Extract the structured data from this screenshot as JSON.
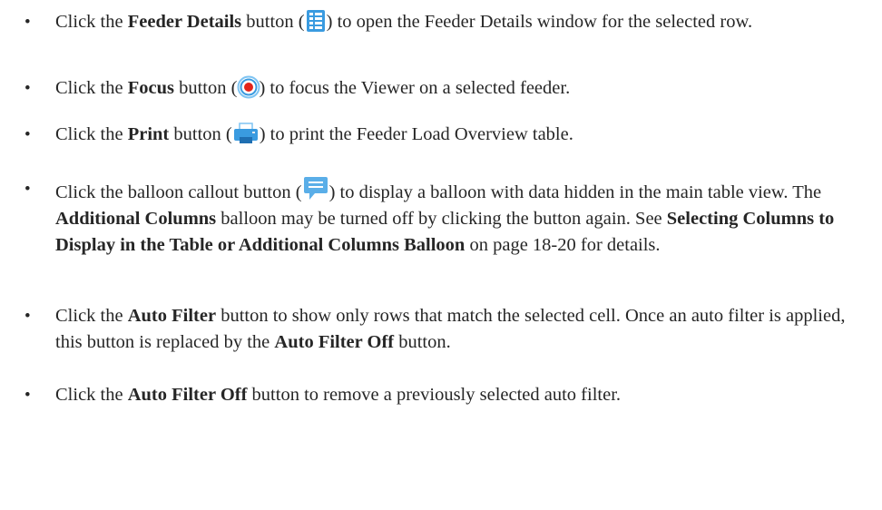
{
  "bullet_char": "•",
  "items": [
    {
      "segments": [
        {
          "text": "Click the ",
          "bold": false
        },
        {
          "text": "Feeder Details",
          "bold": true
        },
        {
          "text": " button (",
          "bold": false
        },
        {
          "icon": "feeder-details-icon"
        },
        {
          "text": ") to open the Feeder Details window for the selected row.",
          "bold": false
        }
      ]
    },
    {
      "segments": [
        {
          "text": "Click the ",
          "bold": false
        },
        {
          "text": "Focus",
          "bold": true
        },
        {
          "text": " button (",
          "bold": false
        },
        {
          "icon": "focus-target-icon"
        },
        {
          "text": ") to focus the Viewer on a selected feeder.",
          "bold": false
        }
      ]
    },
    {
      "segments": [
        {
          "text": "Click the ",
          "bold": false
        },
        {
          "text": "Print",
          "bold": true
        },
        {
          "text": " button (",
          "bold": false
        },
        {
          "icon": "printer-icon"
        },
        {
          "text": ") to print the Feeder Load Overview table.",
          "bold": false
        }
      ]
    },
    {
      "segments": [
        {
          "text": "Click the balloon callout button (",
          "bold": false
        },
        {
          "icon": "balloon-callout-icon"
        },
        {
          "text": ") to display a balloon with data hidden in the main table view. The ",
          "bold": false
        },
        {
          "text": "Additional Columns",
          "bold": true
        },
        {
          "text": " balloon may be turned off by clicking the button again. See ",
          "bold": false
        },
        {
          "text": "Selecting Columns to Display in the Table or Additional Columns Balloon",
          "bold": true
        },
        {
          "text": " on page 18-20 for details.",
          "bold": false
        }
      ]
    },
    {
      "segments": [
        {
          "text": "Click the ",
          "bold": false
        },
        {
          "text": "Auto Filter",
          "bold": true
        },
        {
          "text": " button to show only rows that match the selected cell. Once an auto filter is applied, this button is replaced by the ",
          "bold": false
        },
        {
          "text": "Auto Filter Off",
          "bold": true
        },
        {
          "text": " button.",
          "bold": false
        }
      ]
    },
    {
      "segments": [
        {
          "text": "Click the ",
          "bold": false
        },
        {
          "text": "Auto Filter Off",
          "bold": true
        },
        {
          "text": " button to remove a previously selected auto filter.",
          "bold": false
        }
      ]
    }
  ],
  "colors": {
    "text": "#262626",
    "icon_blue": "#3a9be0",
    "icon_light_blue": "#7fc4f2",
    "icon_red": "#e2231a"
  }
}
